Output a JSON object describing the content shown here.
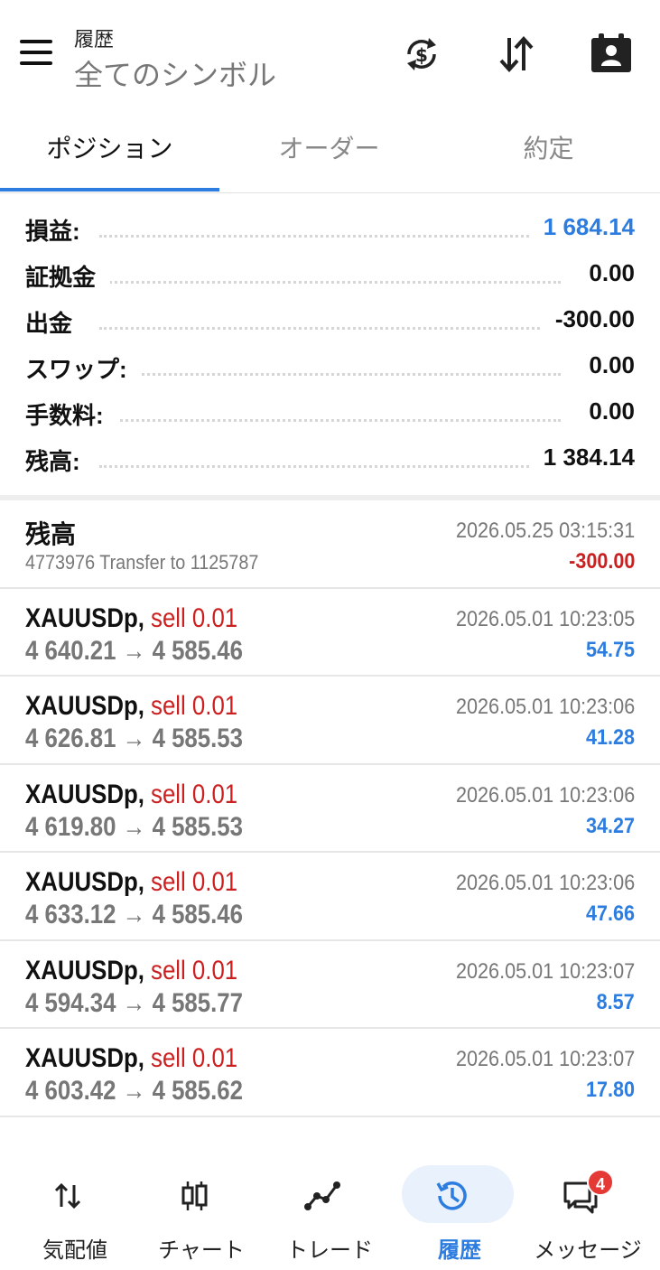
{
  "header": {
    "title": "履歴",
    "subtitle": "全てのシンボル",
    "icons": [
      "menu-icon",
      "currency-exchange-icon",
      "sort-icon",
      "account-icon"
    ]
  },
  "tabs": [
    {
      "label": "ポジション",
      "active": true
    },
    {
      "label": "オーダー",
      "active": false
    },
    {
      "label": "約定",
      "active": false
    }
  ],
  "summary": [
    {
      "label": "損益:",
      "value": "1 684.14",
      "color": "#2d7de0"
    },
    {
      "label": "証拠金",
      "value": "0.00"
    },
    {
      "label": "出金",
      "value": "-300.00"
    },
    {
      "label": "スワップ:",
      "value": "0.00"
    },
    {
      "label": "手数料:",
      "value": "0.00"
    },
    {
      "label": "残高:",
      "value": "1 384.14"
    }
  ],
  "balance_entry": {
    "title": "残高",
    "comment": "4773976 Transfer to 1125787",
    "time": "2026.05.25 03:15:31",
    "amount": "-300.00"
  },
  "deals": [
    {
      "symbol": "XAUUSDp,",
      "side": "sell 0.01",
      "prices": "4 640.21 → 4 585.46",
      "time": "2026.05.01 10:23:05",
      "profit": "54.75"
    },
    {
      "symbol": "XAUUSDp,",
      "side": "sell 0.01",
      "prices": "4 626.81 → 4 585.53",
      "time": "2026.05.01 10:23:06",
      "profit": "41.28"
    },
    {
      "symbol": "XAUUSDp,",
      "side": "sell 0.01",
      "prices": "4 619.80 → 4 585.53",
      "time": "2026.05.01 10:23:06",
      "profit": "34.27"
    },
    {
      "symbol": "XAUUSDp,",
      "side": "sell 0.01",
      "prices": "4 633.12 → 4 585.46",
      "time": "2026.05.01 10:23:06",
      "profit": "47.66"
    },
    {
      "symbol": "XAUUSDp,",
      "side": "sell 0.01",
      "prices": "4 594.34 → 4 585.77",
      "time": "2026.05.01 10:23:07",
      "profit": "8.57"
    },
    {
      "symbol": "XAUUSDp,",
      "side": "sell 0.01",
      "prices": "4 603.42 → 4 585.62",
      "time": "2026.05.01 10:23:07",
      "profit": "17.80"
    }
  ],
  "bottom_nav": [
    {
      "label": "気配値",
      "icon": "quotes-icon"
    },
    {
      "label": "チャート",
      "icon": "chart-icon"
    },
    {
      "label": "トレード",
      "icon": "trade-icon"
    },
    {
      "label": "履歴",
      "icon": "history-icon",
      "active": true
    },
    {
      "label": "メッセージ",
      "icon": "messages-icon",
      "badge": "4"
    }
  ],
  "colors": {
    "accent": "#2d7de0",
    "loss": "#cc1f1f",
    "text_muted": "#777777"
  }
}
